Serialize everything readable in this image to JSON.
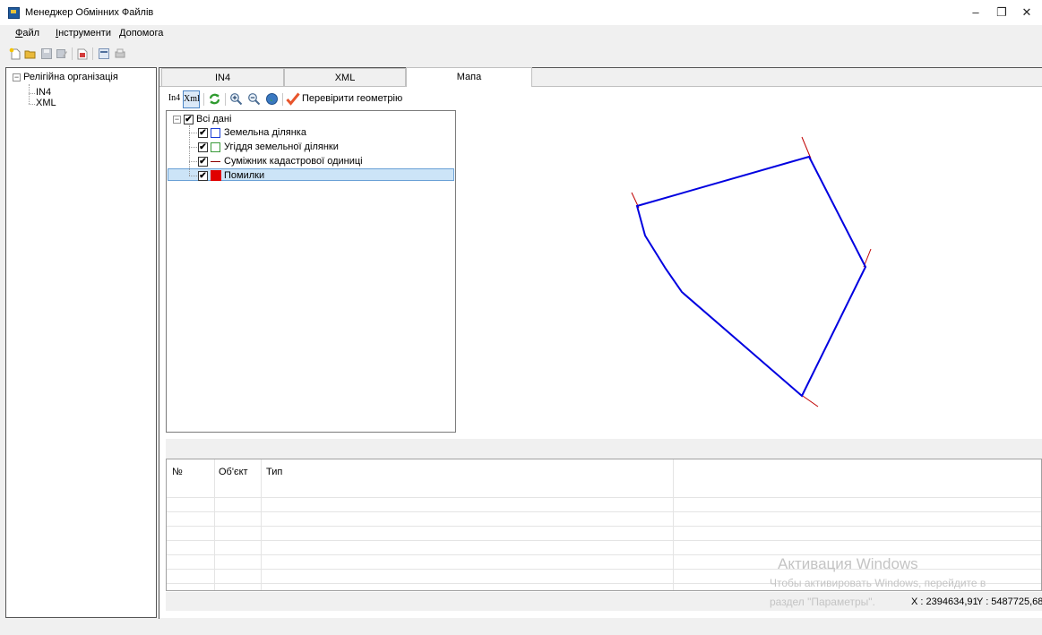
{
  "window": {
    "title": "Менеджер Обмінних Файлів",
    "controls": {
      "minimize": "–",
      "restore": "❐",
      "close": "✕"
    }
  },
  "menu": {
    "items": [
      {
        "label": "Файл"
      },
      {
        "label": "Інструменти"
      },
      {
        "label": "Допомога"
      }
    ]
  },
  "toolbar": {
    "icons": [
      "new-icon",
      "open-icon",
      "save-icon",
      "save-as-icon",
      "validate-icon",
      "export-icon",
      "print-icon"
    ]
  },
  "sidebar": {
    "root": {
      "label": "Релігійна організація",
      "expander": "−"
    },
    "children": [
      {
        "label": "IN4"
      },
      {
        "label": "XML"
      }
    ]
  },
  "tabs": [
    {
      "label": "IN4",
      "active": false
    },
    {
      "label": "XML",
      "active": false
    },
    {
      "label": "Мапа",
      "active": true
    }
  ],
  "map_toolbar": {
    "in4_label": "In4",
    "xml_label": "Xml",
    "check_geometry_label": "Перевірити геометрію"
  },
  "layers": {
    "root": {
      "label": "Всі дані",
      "checked": true,
      "expander": "−",
      "check_mark": "✔"
    },
    "items": [
      {
        "label": "Земельна ділянка",
        "check_mark": "✔",
        "swatch": "outline",
        "color": "#1c3fd6"
      },
      {
        "label": "Угіддя земельної ділянки",
        "check_mark": "✔",
        "swatch": "outline",
        "color": "#3a9a3a"
      },
      {
        "label": "Суміжник кадастрової одиниці",
        "check_mark": "✔",
        "swatch": "line",
        "color": "#8b0000"
      },
      {
        "label": "Помилки",
        "check_mark": "✔",
        "swatch": "fill",
        "color": "#e00000",
        "selected": true
      }
    ]
  },
  "map": {
    "parcel_color": "#0000e0",
    "adjacent_color": "#c00000"
  },
  "errors_grid": {
    "columns": [
      {
        "label": "№"
      },
      {
        "label": "Об'єкт"
      },
      {
        "label": "Тип"
      }
    ],
    "rows": []
  },
  "status": {
    "x_label": "X : 2394634,91",
    "y_label": "Y : 5487725,68"
  },
  "watermark": {
    "title": "Активация Windows",
    "line1": "Чтобы активировать Windows, перейдите в",
    "line2": "раздел \"Параметры\"."
  }
}
